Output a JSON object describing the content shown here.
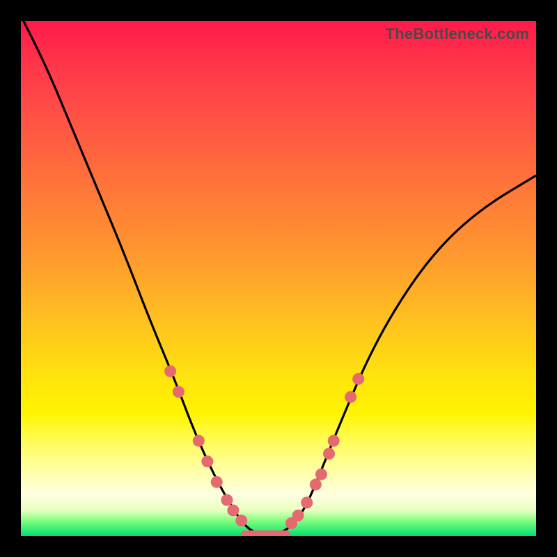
{
  "watermark": "TheBottleneck.com",
  "chart_data": {
    "type": "line",
    "title": "",
    "xlabel": "",
    "ylabel": "",
    "xlim": [
      0,
      100
    ],
    "ylim": [
      0,
      100
    ],
    "background": "vertical-gradient red→orange→yellow→green (top→bottom)",
    "series": [
      {
        "name": "bottleneck-curve",
        "x": [
          0,
          5,
          10,
          15,
          20,
          25,
          30,
          33,
          36,
          39,
          42,
          44,
          46,
          48,
          50,
          52,
          55,
          58,
          62,
          68,
          75,
          82,
          90,
          100
        ],
        "y": [
          101,
          91,
          79,
          67,
          55,
          42,
          30,
          22,
          15,
          9,
          4,
          1.5,
          0.5,
          0.5,
          0.5,
          1.5,
          5,
          12,
          22,
          36,
          48,
          57,
          64,
          70
        ]
      }
    ],
    "markers": [
      {
        "name": "left-dot-1",
        "x": 29.0,
        "y": 32.0
      },
      {
        "name": "left-dot-2",
        "x": 30.6,
        "y": 28.0
      },
      {
        "name": "left-dot-3",
        "x": 34.5,
        "y": 18.5
      },
      {
        "name": "left-dot-4",
        "x": 36.2,
        "y": 14.5
      },
      {
        "name": "left-dot-5",
        "x": 38.0,
        "y": 10.5
      },
      {
        "name": "left-dot-6",
        "x": 40.0,
        "y": 7.0
      },
      {
        "name": "left-dot-7",
        "x": 41.2,
        "y": 5.0
      },
      {
        "name": "left-dot-8",
        "x": 42.8,
        "y": 3.0
      },
      {
        "name": "right-dot-1",
        "x": 52.5,
        "y": 2.5
      },
      {
        "name": "right-dot-2",
        "x": 53.8,
        "y": 4.0
      },
      {
        "name": "right-dot-3",
        "x": 55.5,
        "y": 6.5
      },
      {
        "name": "right-dot-4",
        "x": 57.2,
        "y": 10.0
      },
      {
        "name": "right-dot-5",
        "x": 58.3,
        "y": 12.0
      },
      {
        "name": "right-dot-6",
        "x": 59.8,
        "y": 16.0
      },
      {
        "name": "right-dot-7",
        "x": 60.7,
        "y": 18.5
      },
      {
        "name": "right-dot-8",
        "x": 64.0,
        "y": 27.0
      },
      {
        "name": "right-dot-9",
        "x": 65.5,
        "y": 30.5
      }
    ],
    "flat_segment": {
      "x_start": 43.5,
      "x_end": 51.5,
      "y": 0.3
    },
    "colors": {
      "curve": "#000000",
      "markers": "#e46a70",
      "gradient_top": "#ff1a4a",
      "gradient_mid": "#ffe010",
      "gradient_bottom": "#00e070",
      "frame": "#000000"
    }
  }
}
